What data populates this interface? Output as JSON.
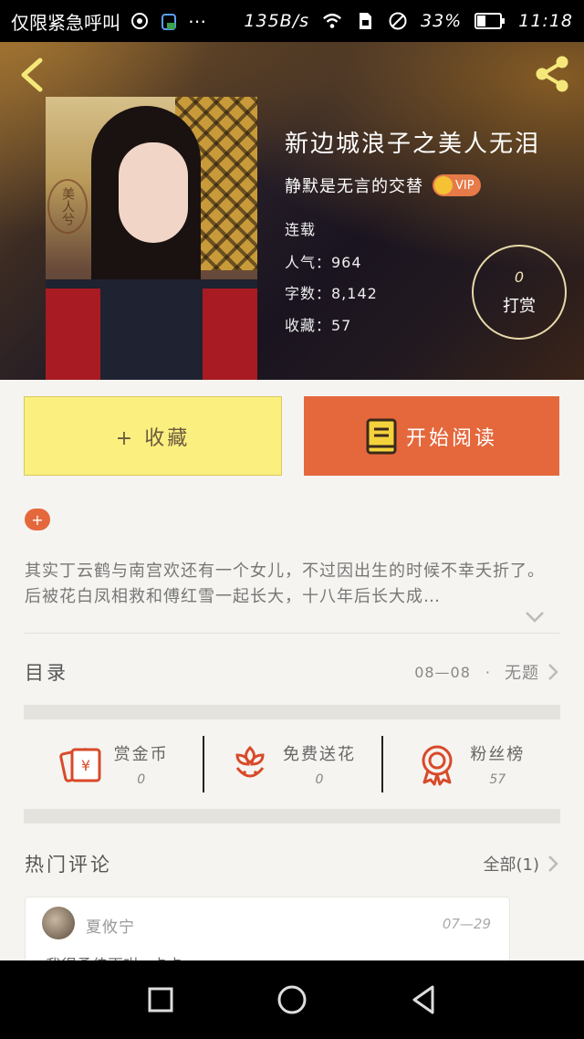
{
  "status_bar": {
    "carrier": "仅限紧急呼叫",
    "speed": "135B/s",
    "battery": "33%",
    "time": "11:18"
  },
  "book": {
    "title": "新边城浪子之美人无泪",
    "author": "静默是无言的交替",
    "vip_label": "VIP",
    "status": "连载",
    "popularity": "人气：964",
    "word_count": "字数：8,142",
    "favorites": "收藏：57",
    "cover_seal": "美人兮",
    "reward_count": "0",
    "reward_label": "打赏"
  },
  "buttons": {
    "collect": "+ 收藏",
    "read": "开始阅读"
  },
  "expand_tag": "+",
  "description": "其实丁云鹤与南宫欢还有一个女儿，不过因出生的时候不幸夭折了。后被花白凤相救和傅红雪一起长大，十八年后长大成…",
  "catalog": {
    "label": "目录",
    "date": "08—08",
    "separator": "·",
    "chapter": "无题"
  },
  "actions": [
    {
      "label": "赏金币",
      "count": "0",
      "icon": "money-envelope-icon"
    },
    {
      "label": "免费送花",
      "count": "0",
      "icon": "flower-icon"
    },
    {
      "label": "粉丝榜",
      "count": "57",
      "icon": "medal-icon"
    }
  ],
  "comments_section": {
    "label": "热门评论",
    "all": "全部(1)"
  },
  "comments": [
    {
      "user": "夏攸宁",
      "date": "07—29",
      "text": "我得柔佳更咁~卡卡"
    }
  ],
  "colors": {
    "accent": "#e5683d",
    "collect_bg": "#fbf07f",
    "page_bg": "#f5f4f0"
  }
}
